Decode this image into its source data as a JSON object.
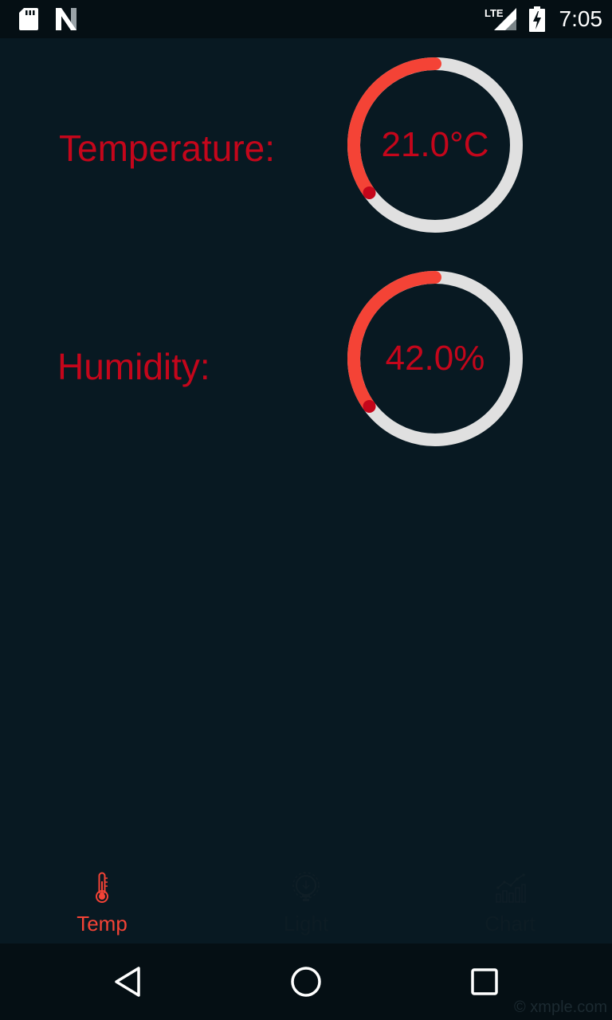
{
  "status_bar": {
    "time": "7:05",
    "network": "LTE",
    "icons": [
      "sd-card-icon",
      "n-logo-icon",
      "lte-signal-icon",
      "battery-charging-icon"
    ]
  },
  "readings": {
    "temperature": {
      "label": "Temperature:",
      "value": "21.0°C",
      "progress": 0.35
    },
    "humidity": {
      "label": "Humidity:",
      "value": "42.0%",
      "progress": 0.35
    }
  },
  "colors": {
    "accent": "#f44336",
    "label_text": "#c4061b",
    "gauge_track": "#e0e0e0",
    "gauge_dot": "#c4061b",
    "background": "#081922",
    "bar_background": "#050f14"
  },
  "bottom_nav": {
    "items": [
      {
        "label": "Temp",
        "icon": "thermometer-icon",
        "active": true
      },
      {
        "label": "Light",
        "icon": "lightbulb-icon",
        "active": false
      },
      {
        "label": "Chart",
        "icon": "bar-chart-icon",
        "active": false
      }
    ]
  },
  "system_nav": {
    "buttons": [
      "back-icon",
      "home-icon",
      "recents-icon"
    ]
  },
  "watermark": "© xmple.com"
}
